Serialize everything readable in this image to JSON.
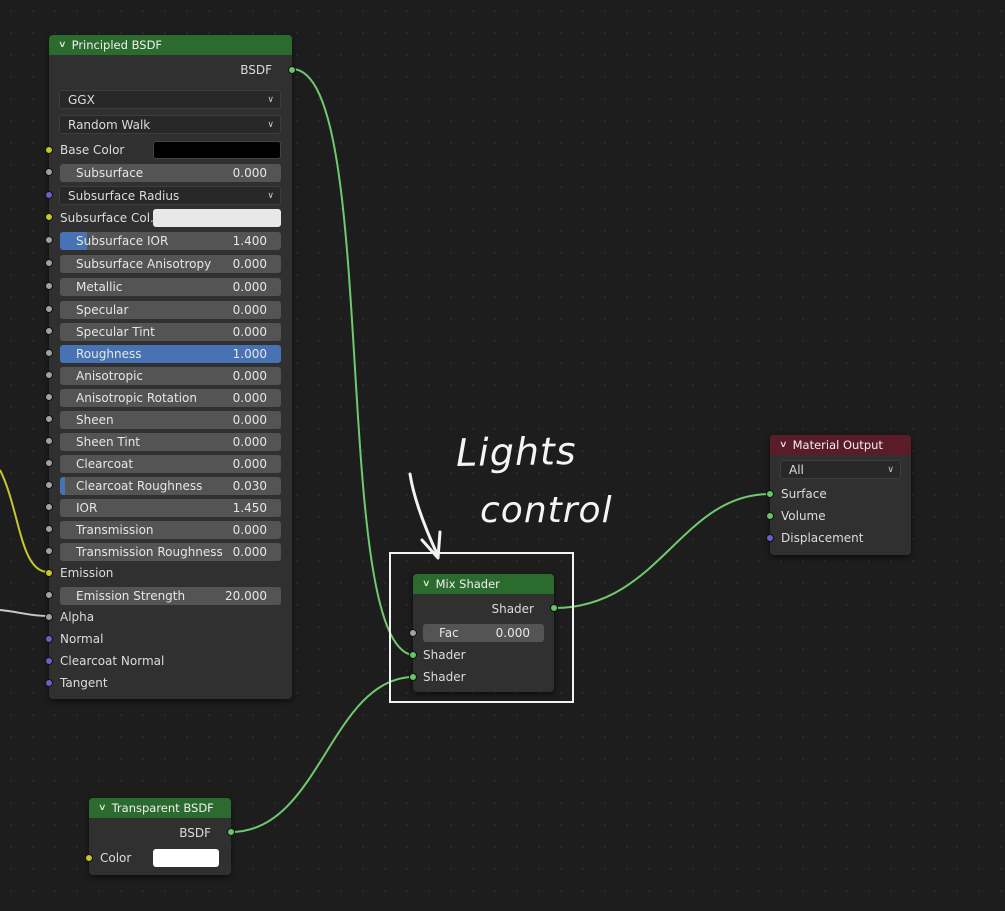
{
  "principled": {
    "title": "Principled BSDF",
    "output": "BSDF",
    "distribution": "GGX",
    "subsurface_method": "Random Walk",
    "base_color_label": "Base Color",
    "base_color": "#000000",
    "subsurface_label": "Subsurface",
    "subsurface_value": "0.000",
    "subsurface_radius": "Subsurface Radius",
    "subsurface_color_label": "Subsurface Col...",
    "subsurface_color": "#e8e8e8",
    "subsurface_ior_label": "Subsurface IOR",
    "subsurface_ior_value": "1.400",
    "subsurface_ior_fill": 0.12,
    "subsurface_aniso_label": "Subsurface Anisotropy",
    "subsurface_aniso_value": "0.000",
    "metallic_label": "Metallic",
    "metallic_value": "0.000",
    "specular_label": "Specular",
    "specular_value": "0.000",
    "specular_tint_label": "Specular Tint",
    "specular_tint_value": "0.000",
    "roughness_label": "Roughness",
    "roughness_value": "1.000",
    "roughness_fill": 1.0,
    "anisotropic_label": "Anisotropic",
    "anisotropic_value": "0.000",
    "aniso_rotation_label": "Anisotropic Rotation",
    "aniso_rotation_value": "0.000",
    "sheen_label": "Sheen",
    "sheen_value": "0.000",
    "sheen_tint_label": "Sheen Tint",
    "sheen_tint_value": "0.000",
    "clearcoat_label": "Clearcoat",
    "clearcoat_value": "0.000",
    "clearcoat_rough_label": "Clearcoat Roughness",
    "clearcoat_rough_value": "0.030",
    "clearcoat_rough_fill": 0.03,
    "ior_label": "IOR",
    "ior_value": "1.450",
    "transmission_label": "Transmission",
    "transmission_value": "0.000",
    "transmission_rough_label": "Transmission Roughness",
    "transmission_rough_value": "0.000",
    "emission_label": "Emission",
    "emission_strength_label": "Emission Strength",
    "emission_strength_value": "20.000",
    "alpha_label": "Alpha",
    "normal_label": "Normal",
    "clearcoat_normal_label": "Clearcoat Normal",
    "tangent_label": "Tangent"
  },
  "mix": {
    "title": "Mix Shader",
    "output": "Shader",
    "fac_label": "Fac",
    "fac_value": "0.000",
    "input1": "Shader",
    "input2": "Shader"
  },
  "output_node": {
    "title": "Material Output",
    "target": "All",
    "surface": "Surface",
    "volume": "Volume",
    "displacement": "Displacement"
  },
  "transparent": {
    "title": "Transparent BSDF",
    "output": "BSDF",
    "color_label": "Color",
    "color": "#ffffff"
  },
  "annotation": {
    "line1": "Lights",
    "line2": "control"
  },
  "colors": {
    "shader_socket": "#63c763",
    "color_socket": "#c7c729",
    "float_socket": "#a1a1a1",
    "vector_socket": "#6363c7",
    "shader_header": "#2c6b2e",
    "output_header": "#5a1c28",
    "active_field": "#4772b3"
  }
}
